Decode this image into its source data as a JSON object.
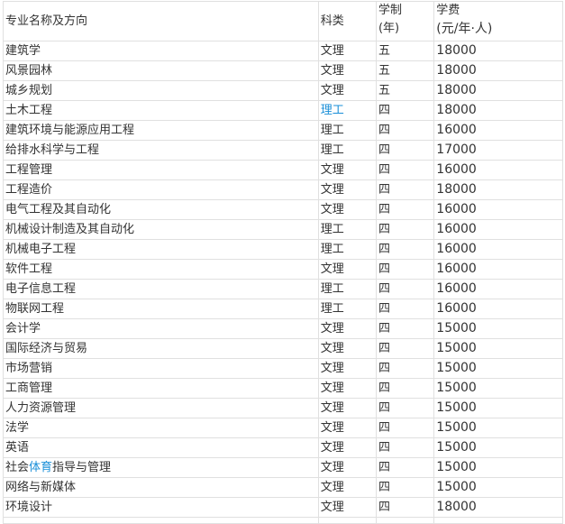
{
  "header": {
    "major": "专业名称及方向",
    "category": "科类",
    "years_line1": "学制",
    "years_line2": "(年)",
    "fee_line1": "学费",
    "fee_line2": "(元/年·人)"
  },
  "rows": [
    {
      "name": "建筑学",
      "category": "文理",
      "years": "五",
      "fee": "18000"
    },
    {
      "name": "风景园林",
      "category": "文理",
      "years": "五",
      "fee": "18000"
    },
    {
      "name": "城乡规划",
      "category": "文理",
      "years": "五",
      "fee": "18000"
    },
    {
      "name": "土木工程",
      "category": "理工",
      "years": "四",
      "fee": "18000",
      "category_link": true
    },
    {
      "name": "建筑环境与能源应用工程",
      "category": "理工",
      "years": "四",
      "fee": "16000"
    },
    {
      "name": "给排水科学与工程",
      "category": "理工",
      "years": "四",
      "fee": "17000"
    },
    {
      "name": "工程管理",
      "category": "文理",
      "years": "四",
      "fee": "16000"
    },
    {
      "name": "工程造价",
      "category": "文理",
      "years": "四",
      "fee": "18000"
    },
    {
      "name": "电气工程及其自动化",
      "category": "文理",
      "years": "四",
      "fee": "16000"
    },
    {
      "name": "机械设计制造及其自动化",
      "category": "理工",
      "years": "四",
      "fee": "16000"
    },
    {
      "name": "机械电子工程",
      "category": "理工",
      "years": "四",
      "fee": "16000"
    },
    {
      "name": "软件工程",
      "category": "文理",
      "years": "四",
      "fee": "16000"
    },
    {
      "name": "电子信息工程",
      "category": "理工",
      "years": "四",
      "fee": "16000"
    },
    {
      "name": "物联网工程",
      "category": "理工",
      "years": "四",
      "fee": "16000"
    },
    {
      "name": "会计学",
      "category": "文理",
      "years": "四",
      "fee": "15000"
    },
    {
      "name": "国际经济与贸易",
      "category": "文理",
      "years": "四",
      "fee": "15000"
    },
    {
      "name": "市场营销",
      "category": "文理",
      "years": "四",
      "fee": "15000"
    },
    {
      "name": "工商管理",
      "category": "文理",
      "years": "四",
      "fee": "15000"
    },
    {
      "name": "人力资源管理",
      "category": "文理",
      "years": "四",
      "fee": "15000"
    },
    {
      "name": "法学",
      "category": "文理",
      "years": "四",
      "fee": "15000"
    },
    {
      "name": "英语",
      "category": "文理",
      "years": "四",
      "fee": "15000"
    },
    {
      "name": "社会体育指导与管理",
      "name_parts": [
        "社会",
        "体育",
        "指导与管理"
      ],
      "category": "文理",
      "years": "四",
      "fee": "15000"
    },
    {
      "name": "网络与新媒体",
      "category": "文理",
      "years": "四",
      "fee": "15000"
    },
    {
      "name": "环境设计",
      "category": "文理",
      "years": "四",
      "fee": "18000"
    }
  ],
  "link_color": "#1a8fd8"
}
